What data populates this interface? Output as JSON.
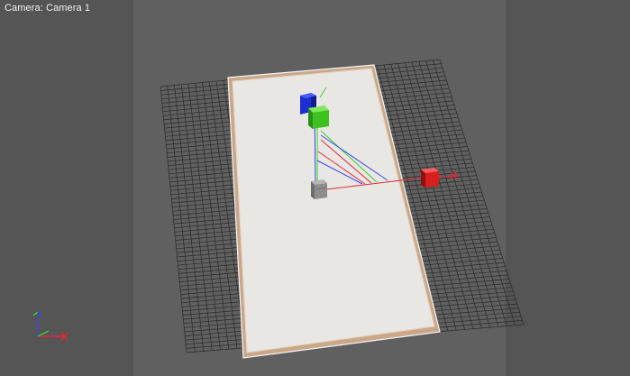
{
  "viewport": {
    "label": "Camera: Camera 1"
  },
  "colors": {
    "background": "#5b5b5b",
    "grid_line": "#2a2a2a",
    "floor": "#e9e7e3",
    "floor_border": "#e3c6a8",
    "cube_blue": "#1c2fd0",
    "cube_green": "#3fc21f",
    "cube_red": "#d81e1e",
    "cube_gray": "#8d8d8d",
    "axis_red": "#e0283a",
    "axis_green": "#35d12f",
    "axis_blue": "#3a45e6"
  },
  "icons": {
    "view_axis": "xyz-axis-icon"
  }
}
